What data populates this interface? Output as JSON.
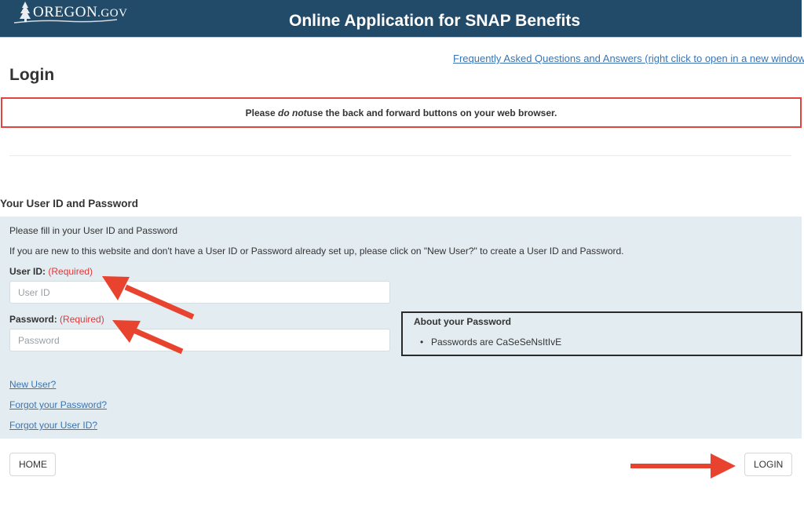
{
  "header": {
    "logo_text_main": "OREGON",
    "logo_text_suffix": ".GOV",
    "title": "Online Application for SNAP Benefits"
  },
  "faq_link": "Frequently Asked Questions and Answers (right click to open in a new window)",
  "page_title": "Login",
  "warning": {
    "before": "Please ",
    "emphasis": "do not",
    "after": " use the back and forward buttons on your web browser."
  },
  "section_heading": "Your User ID and Password",
  "form": {
    "intro_line1": "Please fill in your User ID and Password",
    "intro_line2": "If you are new to this website and don't have a User ID or Password already set up, please click on \"New User?\" to create a User ID and Password.",
    "userid_label": "User ID:",
    "userid_required": "(Required)",
    "userid_placeholder": "User ID",
    "userid_value": "",
    "password_label": "Password:",
    "password_required": "(Required)",
    "password_placeholder": "Password",
    "password_value": ""
  },
  "about_password": {
    "title": "About your Password",
    "items": [
      "Passwords are CaSeSeNsItIvE"
    ]
  },
  "links": {
    "new_user": "New User?",
    "forgot_password": "Forgot your Password?",
    "forgot_userid": "Forgot your User ID?"
  },
  "buttons": {
    "home": "HOME",
    "login": "LOGIN"
  },
  "colors": {
    "header_bg": "#224b6a",
    "link": "#3b74b0",
    "required": "#e0393a",
    "warning_border": "#e1443c",
    "panel_bg": "#e3ecf1",
    "annotation_arrow": "#e8432e"
  }
}
